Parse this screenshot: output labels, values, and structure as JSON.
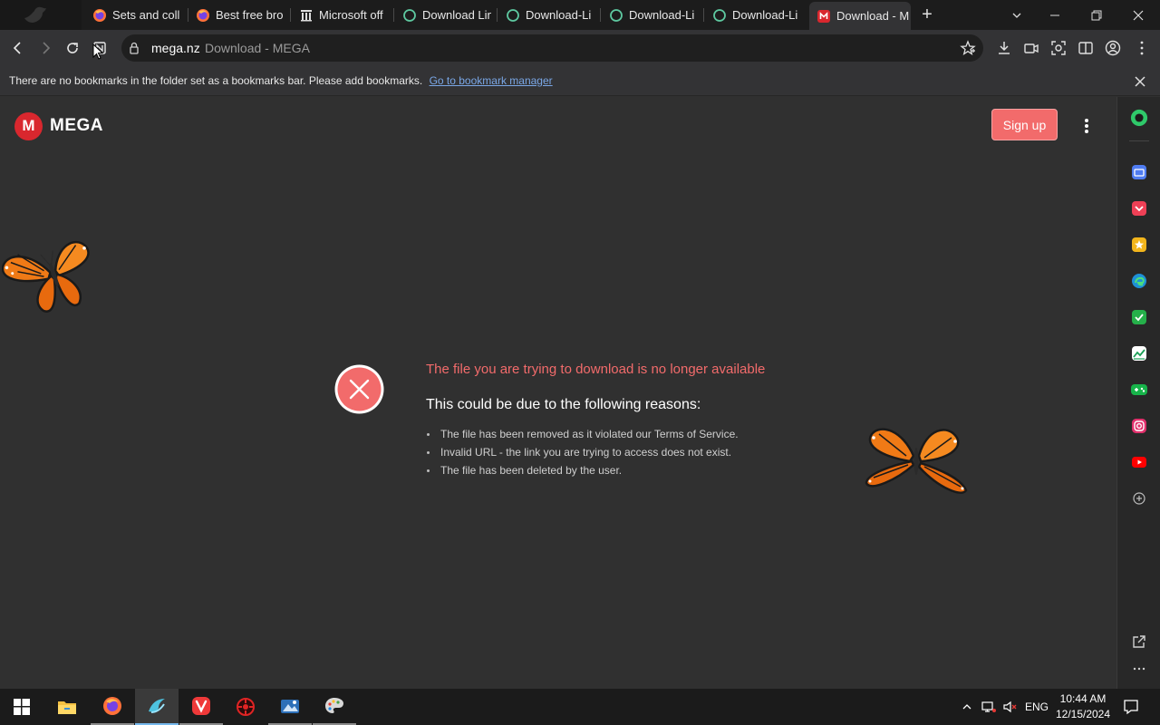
{
  "tabs": [
    {
      "label": "Sets and coll",
      "icon": "firefox-icon"
    },
    {
      "label": "Best free bro",
      "icon": "firefox-icon"
    },
    {
      "label": "Microsoft off",
      "icon": "columns-icon"
    },
    {
      "label": "Download Lin",
      "icon": "loading-ring-icon"
    },
    {
      "label": "Download-Li",
      "icon": "loading-ring-icon"
    },
    {
      "label": "Download-Li",
      "icon": "loading-ring-icon"
    },
    {
      "label": "Download-Li",
      "icon": "loading-ring-icon"
    },
    {
      "label": "Download - M",
      "icon": "mega-icon",
      "active": true
    }
  ],
  "new_tab_label": "+",
  "address": {
    "host": "mega.nz",
    "page_title": "Download - MEGA"
  },
  "bookmarks_bar": {
    "message": "There are no bookmarks in the folder set as a bookmarks bar. Please add bookmarks.",
    "link": "Go to bookmark manager"
  },
  "page": {
    "logo_letter": "M",
    "logo_text": "MEGA",
    "signup_label": "Sign up",
    "error_title": "The file you are trying to download is no longer available",
    "error_subtitle": "This could be due to the following reasons:",
    "reasons": [
      "The file has been removed as it violated our Terms of Service.",
      "Invalid URL - the link you are trying to access does not exist.",
      "The file has been deleted by the user."
    ],
    "colors": {
      "accent": "#f26b6b",
      "brand_red": "#d9272e",
      "background": "#303030"
    }
  },
  "sidebar_icons": [
    "copilot-icon",
    "wallet-icon",
    "pocket-icon",
    "favorites-icon",
    "edge-icon",
    "whatsapp-icon",
    "stock-chart-icon",
    "games-icon",
    "instagram-icon",
    "youtube-icon",
    "add-icon"
  ],
  "taskbar": {
    "apps": [
      "file-explorer",
      "firefox",
      "browser-active",
      "vivaldi",
      "media-app",
      "photo-app",
      "paint-app"
    ],
    "language": "ENG",
    "time": "10:44 AM",
    "date": "12/15/2024"
  }
}
